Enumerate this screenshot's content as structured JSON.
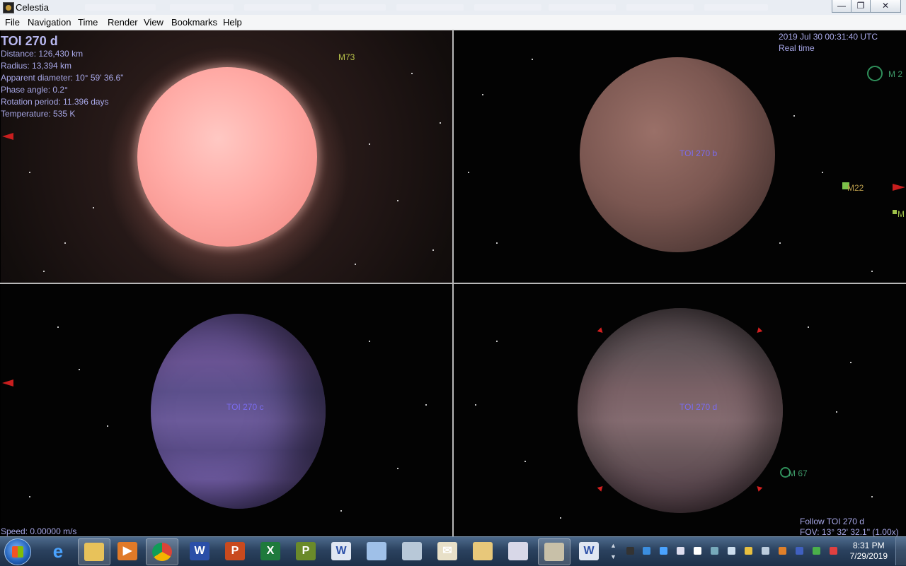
{
  "window": {
    "title": "Celestia"
  },
  "menu": [
    "File",
    "Navigation",
    "Time",
    "Render",
    "View",
    "Bookmarks",
    "Help"
  ],
  "info": {
    "name": "TOI 270 d",
    "lines": [
      "Distance: 126,430 km",
      "Radius: 13,394 km",
      "Apparent diameter: 10° 59' 36.6\"",
      "Phase angle: 0.2°",
      "Rotation period: 11.396 days",
      "Temperature: 535 K"
    ]
  },
  "time": {
    "datetime": "2019 Jul 30 00:31:40 UTC",
    "mode": "Real time"
  },
  "labels": {
    "m73": "M73",
    "m2": "M 2",
    "m22": "M22",
    "m_edge": "M",
    "m67": "M 67",
    "planet_b": "TOI 270 b",
    "planet_c": "TOI 270 c",
    "planet_d": "TOI 270 d"
  },
  "status": {
    "speed": "Speed: 0.00000 m/s",
    "follow": "Follow TOI 270 d",
    "fov": "FOV: 13° 32' 32.1\" (1.00x)"
  },
  "taskbar": {
    "apps": [
      "internet-explorer",
      "file-explorer",
      "media-player",
      "chrome",
      "word",
      "powerpoint",
      "excel",
      "publisher",
      "word-doc",
      "image-viewer",
      "tool",
      "mail",
      "outlook",
      "paint",
      "celestia",
      "word-doc-2"
    ],
    "clock_time": "8:31 PM",
    "clock_date": "7/29/2019"
  },
  "colors": {
    "hud_text": "#a8a8e8",
    "planet_label": "#7b6cf0",
    "dso_label": "#9fbf4a",
    "marker": "#d42020"
  }
}
